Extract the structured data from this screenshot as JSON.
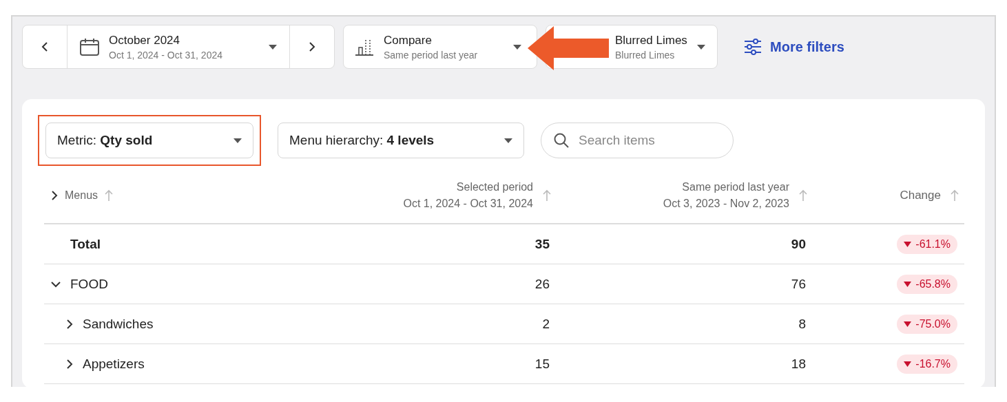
{
  "period": {
    "title": "October 2024",
    "range": "Oct 1, 2024 - Oct 31, 2024"
  },
  "compare": {
    "title": "Compare",
    "subtitle": "Same period last year"
  },
  "location": {
    "title": "Blurred Limes",
    "subtitle": "Blurred Limes"
  },
  "more_filters": "More filters",
  "controls": {
    "metric": {
      "label": "Metric: **Qty sold**",
      "highlighted": true
    },
    "hierarchy": {
      "label": "Menu hierarchy: **4 levels**",
      "highlighted": false
    },
    "search": {
      "placeholder": "Search items"
    }
  },
  "table": {
    "columns": [
      {
        "label": "Menus",
        "expanded": false
      },
      {
        "label": "Selected period",
        "sublabel": "Oct 1, 2024 - Oct 31, 2024"
      },
      {
        "label": "Same period last year",
        "sublabel": "Oct 3, 2023 - Nov 2, 2023"
      },
      {
        "label": "Change"
      }
    ],
    "rows": [
      {
        "kind": "total",
        "name": "Total",
        "selected_period": "35",
        "last_year": "90",
        "change": "-61.1%"
      },
      {
        "kind": "group",
        "name": "FOOD",
        "expanded": true,
        "selected_period": "26",
        "last_year": "76",
        "change": "-65.8%",
        "children": [
          {
            "kind": "group",
            "name": "Sandwiches",
            "expanded": false,
            "selected_period": "2",
            "last_year": "8",
            "change": "-75.0%"
          },
          {
            "kind": "group",
            "name": "Appetizers",
            "expanded": false,
            "selected_period": "15",
            "last_year": "18",
            "change": "-16.7%"
          }
        ]
      }
    ]
  }
}
